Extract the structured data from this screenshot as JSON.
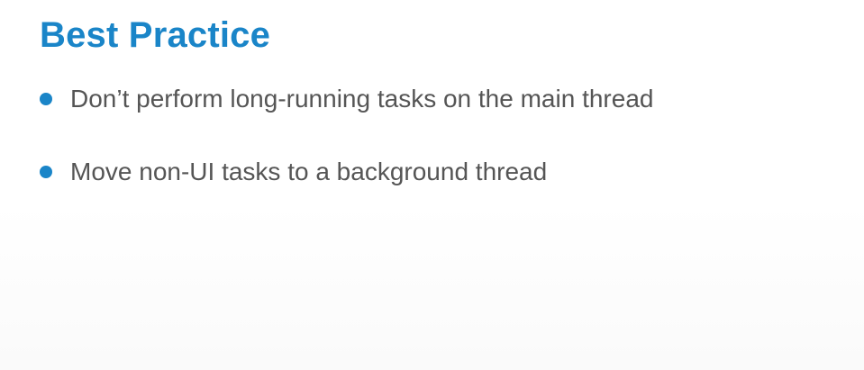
{
  "slide": {
    "title": "Best Practice",
    "accent_color": "#1a85c8",
    "bullets": [
      {
        "text": "Don’t perform long-running tasks on the main thread"
      },
      {
        "text": "Move non-UI tasks to a background thread"
      }
    ]
  }
}
